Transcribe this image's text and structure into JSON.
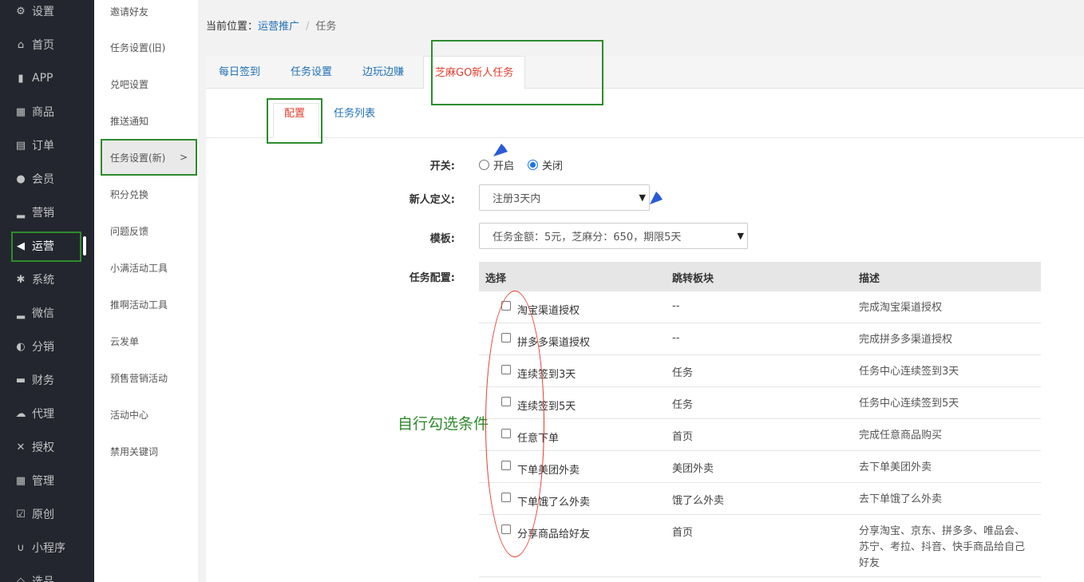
{
  "nav": {
    "items": [
      {
        "label": "设置",
        "icon": "⚙"
      },
      {
        "label": "首页",
        "icon": "⌂"
      },
      {
        "label": "APP",
        "icon": "▮"
      },
      {
        "label": "商品",
        "icon": "▦"
      },
      {
        "label": "订单",
        "icon": "▤"
      },
      {
        "label": "会员",
        "icon": "●"
      },
      {
        "label": "营销",
        "icon": "▂"
      },
      {
        "label": "运营",
        "icon": "◀"
      },
      {
        "label": "系统",
        "icon": "✱"
      },
      {
        "label": "微信",
        "icon": "▂"
      },
      {
        "label": "分销",
        "icon": "◐"
      },
      {
        "label": "财务",
        "icon": "▬"
      },
      {
        "label": "代理",
        "icon": "☁"
      },
      {
        "label": "授权",
        "icon": "✕"
      },
      {
        "label": "管理",
        "icon": "▦"
      },
      {
        "label": "原创",
        "icon": "☑"
      },
      {
        "label": "小程序",
        "icon": "∪"
      },
      {
        "label": "选品",
        "icon": "◇"
      }
    ],
    "active_index": 7
  },
  "submenu": {
    "items": [
      "邀请好友",
      "任务设置(旧)",
      "兑吧设置",
      "推送通知",
      "任务设置(新)",
      "积分兑换",
      "问题反馈",
      "小满活动工具",
      "推啊活动工具",
      "云发单",
      "预售营销活动",
      "活动中心",
      "禁用关键词"
    ],
    "active_arrow": ">"
  },
  "breadcrumb": {
    "prefix": "当前位置：",
    "link": "运营推广",
    "separator": "/",
    "current": "任务"
  },
  "tabs": [
    "每日签到",
    "任务设置",
    "边玩边赚",
    "芝麻GO新人任务"
  ],
  "subtabs": [
    "配置",
    "任务列表"
  ],
  "form": {
    "switch_label": "开关:",
    "switch_on": "开启",
    "switch_off": "关闭",
    "switch_value": "关闭",
    "newuser_label": "新人定义:",
    "newuser_value": "注册3天内",
    "template_label": "模板:",
    "template_value": "任务金额：5元，芝麻分：650，期限5天",
    "taskconf_label": "任务配置:"
  },
  "table": {
    "headers": [
      "选择",
      "跳转板块",
      "描述"
    ],
    "rows": [
      {
        "name": "淘宝渠道授权",
        "target": "--",
        "desc": "完成淘宝渠道授权"
      },
      {
        "name": "拼多多渠道授权",
        "target": "--",
        "desc": "完成拼多多渠道授权"
      },
      {
        "name": "连续签到3天",
        "target": "任务",
        "desc": "任务中心连续签到3天"
      },
      {
        "name": "连续签到5天",
        "target": "任务",
        "desc": "任务中心连续签到5天"
      },
      {
        "name": "任意下单",
        "target": "首页",
        "desc": "完成任意商品购买"
      },
      {
        "name": "下单美团外卖",
        "target": "美团外卖",
        "desc": "去下单美团外卖"
      },
      {
        "name": "下单饿了么外卖",
        "target": "饿了么外卖",
        "desc": "去下单饿了么外卖"
      },
      {
        "name": "分享商品给好友",
        "target": "首页",
        "desc": "分享淘宝、京东、拼多多、唯品会、苏宁、考拉、抖音、快手商品给自己好友"
      }
    ]
  },
  "annotation": "自行勾选条件",
  "colors": {
    "nav_bg": "#23262e",
    "highlight_green": "#2e8b2e",
    "link_blue": "#1e70b6",
    "active_red": "#e03c2c",
    "arrow_blue": "#2a5bd7"
  }
}
